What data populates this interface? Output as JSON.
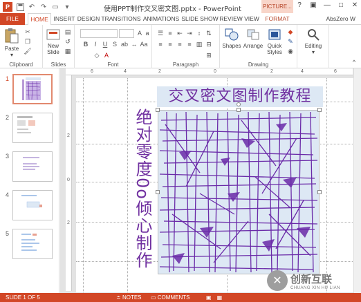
{
  "app": {
    "window_title": "使用PPT制作交叉密文图.pptx - PowerPoint",
    "context_tab_header": "PICTURE...",
    "user": "AbsZero W"
  },
  "tabs": [
    "FILE",
    "HOME",
    "INSERT",
    "DESIGN",
    "TRANSITIONS",
    "ANIMATIONS",
    "SLIDE SHOW",
    "REVIEW",
    "VIEW",
    "FORMAT"
  ],
  "active_tab": "HOME",
  "ribbon": {
    "clipboard": {
      "label": "Clipboard",
      "paste": "Paste"
    },
    "slides": {
      "label": "Slides",
      "new_slide": "New Slide"
    },
    "font": {
      "label": "Font"
    },
    "paragraph": {
      "label": "Paragraph"
    },
    "drawing": {
      "label": "Drawing",
      "shapes": "Shapes",
      "arrange": "Arrange",
      "quick_styles": "Quick Styles"
    },
    "editing": {
      "label": "Editing"
    }
  },
  "slides_panel": {
    "numbers": [
      "1",
      "2",
      "3",
      "4",
      "5"
    ],
    "selected": "1"
  },
  "rulers": {
    "horizontal": [
      "6",
      "4",
      "2",
      "0",
      "2",
      "4",
      "6"
    ],
    "vertical": [
      "2",
      "0",
      "2"
    ]
  },
  "slide": {
    "title": "交叉密文图制作教程",
    "vertical_text": "绝对零度0o倾心制作"
  },
  "statusbar": {
    "slide_of": "SLIDE 1 OF 5",
    "notes": "NOTES",
    "comments": "COMMENTS"
  },
  "watermark": {
    "cn": "创新互联",
    "en": "CHUANG XIN HU LIAN"
  },
  "colors": {
    "accent": "#d24726",
    "title_text": "#7030a0",
    "picture_bg": "#dde8f4",
    "stroke_purple": "#6a2aa8"
  }
}
